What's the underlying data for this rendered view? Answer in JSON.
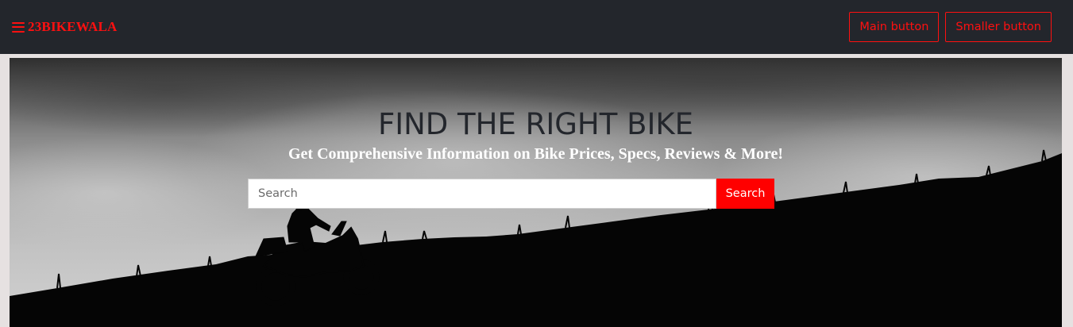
{
  "navbar": {
    "brand_icon": "hamburger-menu-icon",
    "brand": "23BIKEWALA",
    "main_button": "Main button",
    "smaller_button": "Smaller button"
  },
  "hero": {
    "title": "FIND THE RIGHT BIKE",
    "subtitle": "Get Comprehensive Information on Bike Prices, Specs, Reviews & More!",
    "search_placeholder": "Search",
    "search_value": "",
    "search_button": "Search"
  },
  "colors": {
    "accent": "#ff0000",
    "navbar_bg": "#23262c",
    "page_bg": "#e6e1e1"
  }
}
